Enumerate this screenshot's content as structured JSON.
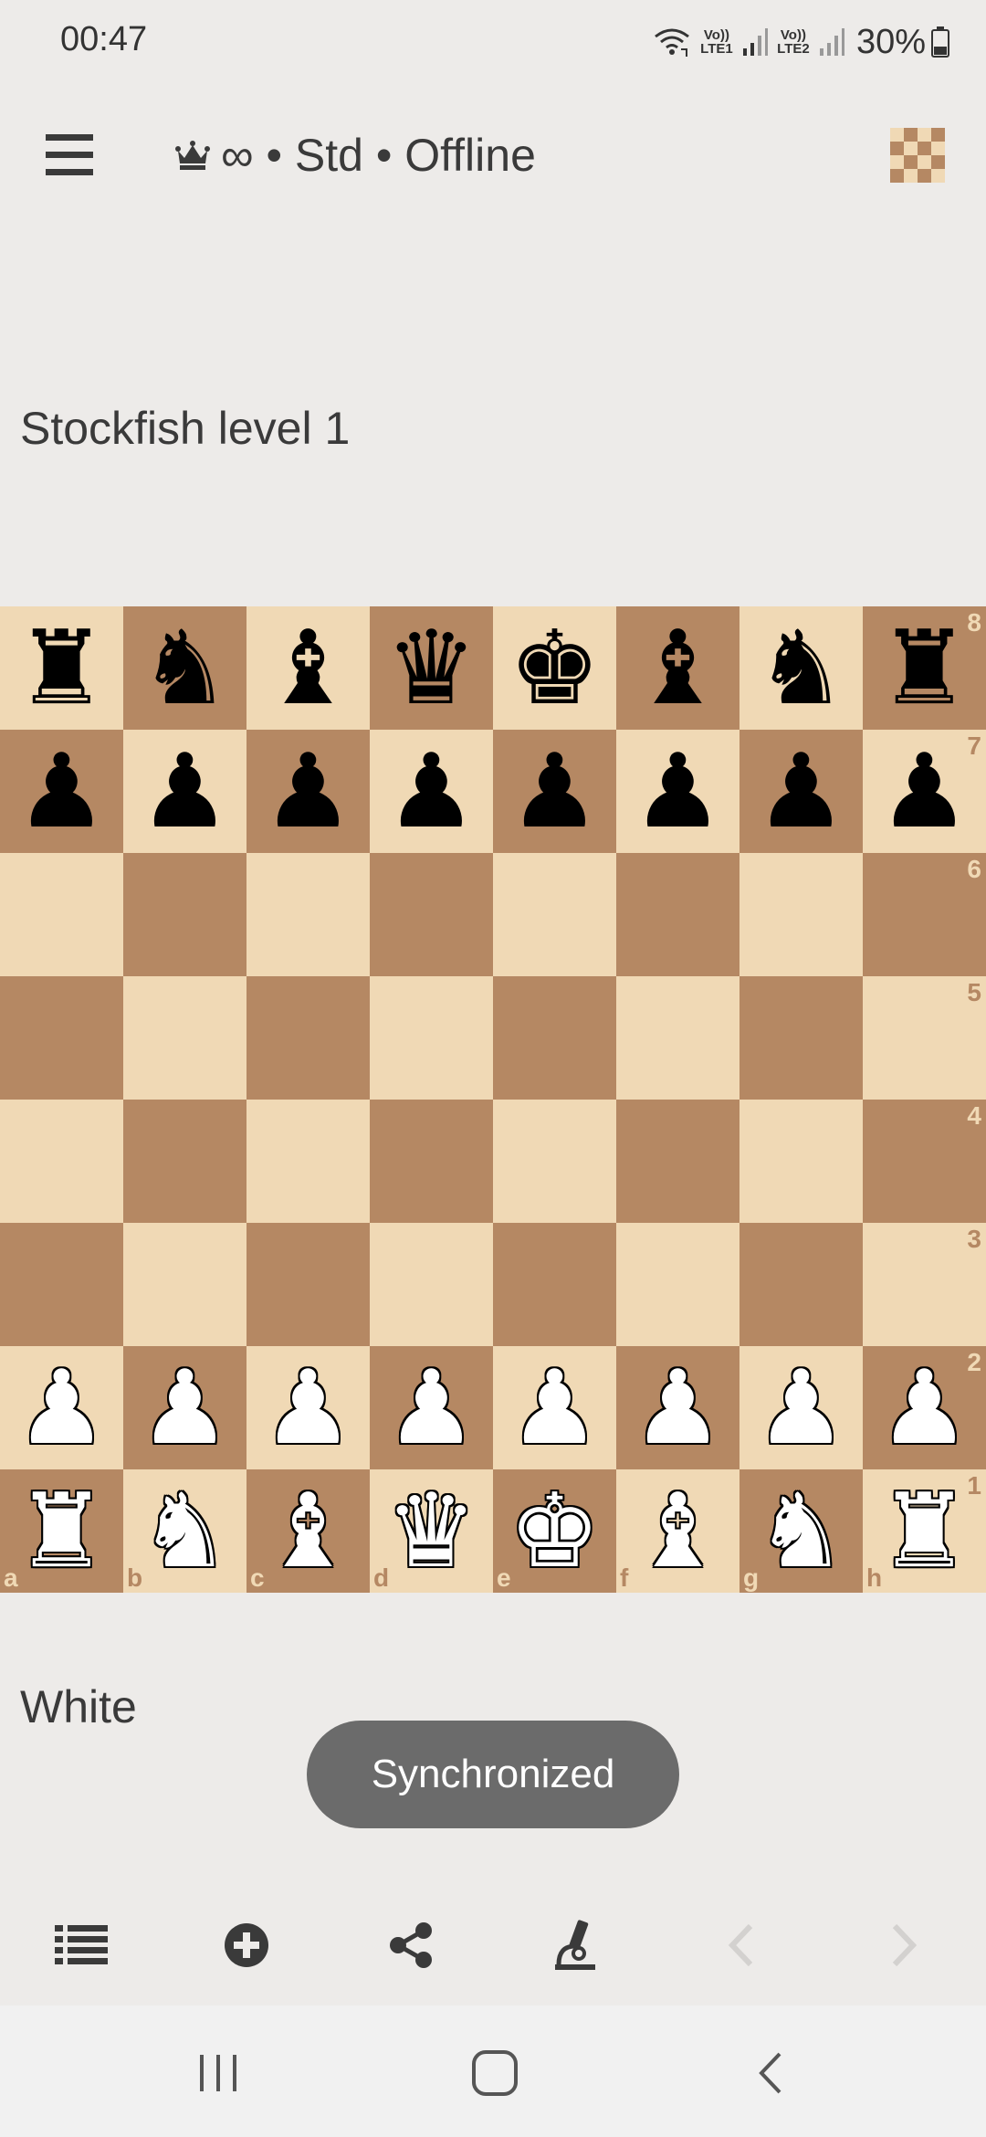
{
  "status_bar": {
    "time": "00:47",
    "sim1_label": "Vo)) LTE1",
    "sim2_label": "Vo)) LTE2",
    "battery": "30%",
    "icons": [
      "wifi-calling-icon",
      "signal-icon",
      "battery-icon"
    ]
  },
  "header": {
    "menu_icon": "hamburger-menu-icon",
    "title": "∞ • Std • Offline",
    "title_icon": "crown-icon",
    "board_icon": "board-theme-icon"
  },
  "players": {
    "opponent": "Stockfish level 1",
    "self": "White"
  },
  "board": {
    "orientation": "white",
    "light_color": "#f0d9b5",
    "dark_color": "#b58863",
    "ranks": [
      "8",
      "7",
      "6",
      "5",
      "4",
      "3",
      "2",
      "1"
    ],
    "files": [
      "a",
      "b",
      "c",
      "d",
      "e",
      "f",
      "g",
      "h"
    ],
    "position_fen": "rnbqkbnr/pppppppp/8/8/8/8/PPPPPPPP/RNBQKBNR"
  },
  "toast": {
    "text": "Synchronized"
  },
  "action_bar": {
    "icons": [
      "move-list-icon",
      "new-game-icon",
      "share-icon",
      "analysis-icon",
      "previous-move-icon",
      "next-move-icon"
    ]
  },
  "system_nav": {
    "icons": [
      "recent-apps-icon",
      "home-icon",
      "back-icon"
    ]
  }
}
